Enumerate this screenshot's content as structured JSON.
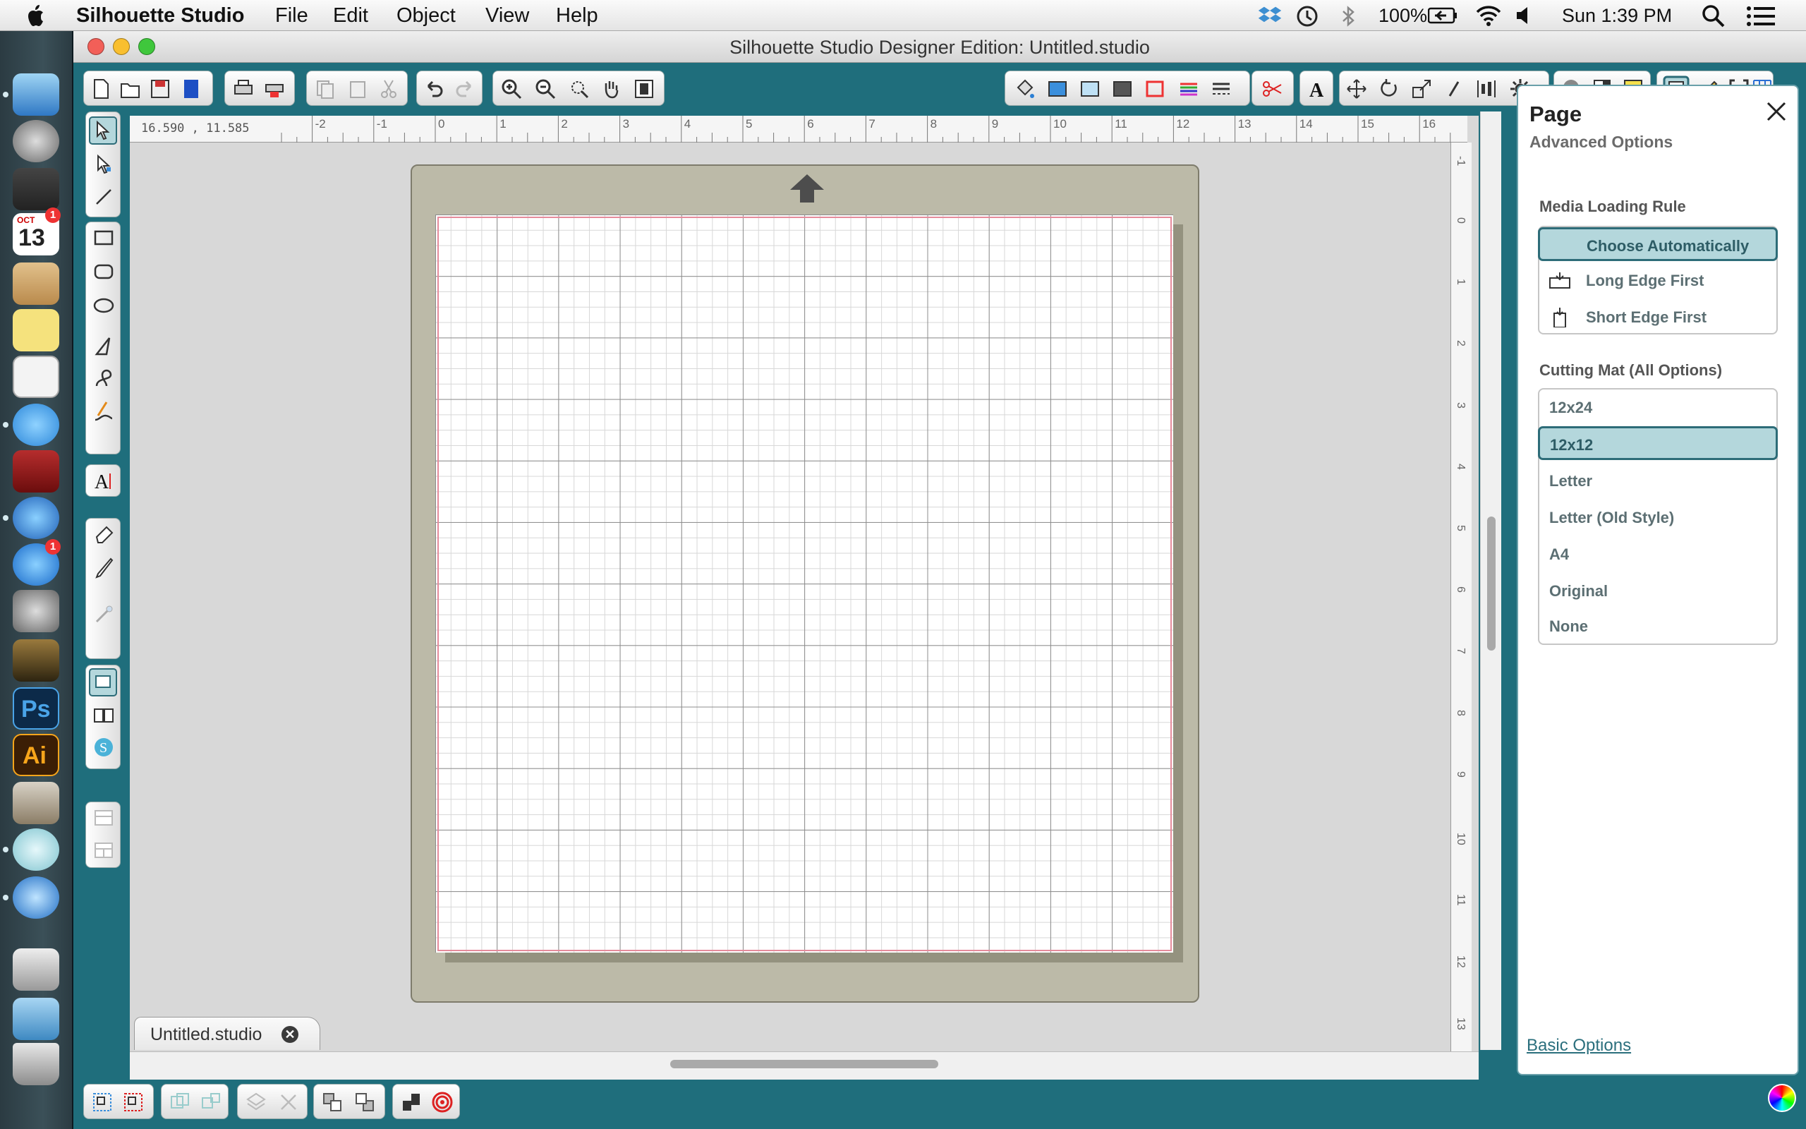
{
  "menubar": {
    "app_name": "Silhouette Studio",
    "items": [
      "File",
      "Edit",
      "Object",
      "View",
      "Help"
    ],
    "battery": "100%",
    "clock": "Sun 1:39 PM"
  },
  "window": {
    "title": "Silhouette Studio Designer Edition: Untitled.studio"
  },
  "dock": {
    "calendar_day": "13",
    "calendar_month": "OCT",
    "badge": "1",
    "ps_label": "Ps",
    "ai_label": "Ai"
  },
  "canvas": {
    "coordinates": "16.590 , 11.585",
    "ruler_top": [
      "-2",
      "-1",
      "0",
      "1",
      "2",
      "3",
      "4",
      "5",
      "6",
      "7",
      "8",
      "9",
      "10",
      "11",
      "12",
      "13",
      "14",
      "15",
      "16"
    ],
    "ruler_right": [
      "-1",
      "0",
      "1",
      "2",
      "3",
      "4",
      "5",
      "6",
      "7",
      "8",
      "9",
      "10",
      "11",
      "12",
      "13"
    ],
    "tab_label": "Untitled.studio",
    "tab_close": "✕"
  },
  "panel": {
    "title": "Page",
    "subtitle": "Advanced Options",
    "media_loading": {
      "label": "Media Loading Rule",
      "options": [
        "Choose Automatically",
        "Long Edge First",
        "Short Edge First"
      ],
      "selected": "Choose Automatically"
    },
    "cutting_mat": {
      "label": "Cutting Mat (All Options)",
      "options": [
        "12x24",
        "12x12",
        "Letter",
        "Letter (Old Style)",
        "A4",
        "Original",
        "None"
      ],
      "selected": "12x12"
    },
    "basic_link": "Basic Options"
  },
  "colors": {
    "accent": "#1f6e7c",
    "selected_fill": "#b4d7dc",
    "page_border": "#e58b9b",
    "mat": "#bcbaa8"
  },
  "icons": {
    "toolbar_top": [
      "new-doc-icon",
      "open-icon",
      "save-icon",
      "save-sd-icon",
      "print-icon",
      "cut-print-icon",
      "copy-icon",
      "paste-icon",
      "cut-icon",
      "undo-icon",
      "redo-icon",
      "zoom-in-icon",
      "zoom-out-icon",
      "zoom-select-icon",
      "pan-icon",
      "fit-page-icon",
      "fill-icon",
      "fill-color-icon",
      "fill-pattern-icon",
      "fill-gradient-icon",
      "offset-icon",
      "line-color-icon",
      "line-style-icon",
      "cut-style-icon",
      "text-style-icon",
      "transform-icon",
      "rotate-icon",
      "scale-icon",
      "shear-icon",
      "align-icon",
      "replicate-icon",
      "library-icon",
      "page-settings-icon",
      "registration-icon",
      "design-page-icon",
      "sketch-icon",
      "trace-icon",
      "grid-icon"
    ],
    "toolbar_left": [
      "select-tool-icon",
      "point-edit-icon",
      "line-tool-icon",
      "rectangle-tool-icon",
      "rounded-rect-tool-icon",
      "ellipse-tool-icon",
      "polygon-tool-icon",
      "curve-tool-icon",
      "freehand-tool-icon",
      "text-tool-icon",
      "eraser-tool-icon",
      "knife-tool-icon",
      "magic-wand-icon",
      "design-view-icon",
      "library-view-icon",
      "store-icon",
      "split-view-h-icon",
      "split-view-v-icon"
    ],
    "toolbar_bottom": [
      "group-icon",
      "ungroup-icon",
      "compound-icon",
      "release-compound-icon",
      "delete-icon",
      "weld-icon",
      "bring-front-icon",
      "send-back-icon",
      "modify-icon",
      "offset-shape-icon"
    ]
  }
}
